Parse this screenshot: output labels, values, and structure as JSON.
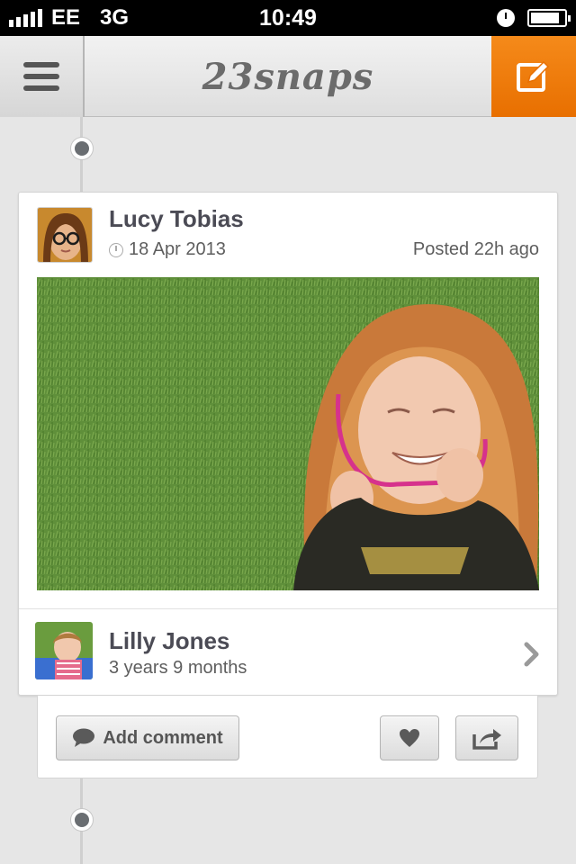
{
  "status_bar": {
    "carrier": "EE",
    "network": "3G",
    "time": "10:49",
    "signal_bars": 5,
    "battery_level": 0.85
  },
  "nav": {
    "title": "23snaps",
    "menu_icon": "hamburger-menu-icon",
    "compose_icon": "compose-edit-icon",
    "accent_color": "#f07d0c"
  },
  "post": {
    "author_name": "Lucy Tobias",
    "date": "18 Apr 2013",
    "posted_ago": "Posted 22h ago",
    "date_icon": "clock-icon"
  },
  "child": {
    "name": "Lilly Jones",
    "age": "3 years 9 months"
  },
  "actions": {
    "comment_label": "Add comment",
    "comment_icon": "speech-bubble-icon",
    "like_icon": "heart-icon",
    "share_icon": "share-arrow-icon"
  }
}
